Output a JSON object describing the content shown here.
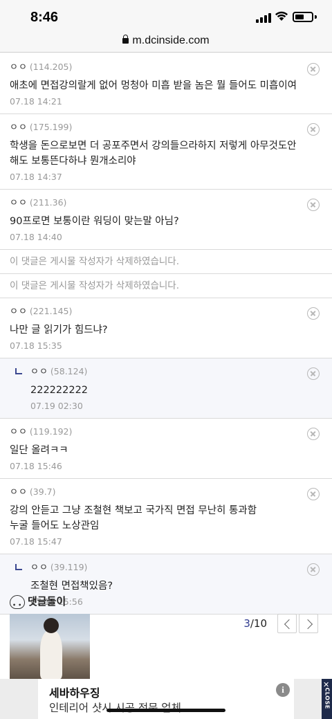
{
  "status_bar": {
    "time": "8:46"
  },
  "browser": {
    "url": "m.dcinside.com"
  },
  "comments": [
    {
      "type": "comment",
      "nick": "ㅇㅇ",
      "ip": "(114.205)",
      "text": "애초에 면접강의랄게 없어 멍청아 미흡 받을 놈은 뭘 들어도 미흡이여",
      "date": "07.18 14:21"
    },
    {
      "type": "comment",
      "nick": "ㅇㅇ",
      "ip": "(175.199)",
      "text": "학생을 돈으로보면 더 공포주면서 강의들으라하지 저렇게 아무것도안해도 보통뜬다하냐 뭔개소리야",
      "date": "07.18 14:37"
    },
    {
      "type": "comment",
      "nick": "ㅇㅇ",
      "ip": "(211.36)",
      "text": "90프로면 보통이란 워딩이 맞는말 아님?",
      "date": "07.18 14:40"
    },
    {
      "type": "deleted",
      "text": "이 댓글은 게시물 작성자가 삭제하였습니다."
    },
    {
      "type": "deleted",
      "text": "이 댓글은 게시물 작성자가 삭제하였습니다."
    },
    {
      "type": "comment",
      "nick": "ㅇㅇ",
      "ip": "(221.145)",
      "text": "나만 글 읽기가 힘드냐?",
      "date": "07.18 15:35"
    },
    {
      "type": "reply",
      "nick": "ㅇㅇ",
      "ip": "(58.124)",
      "text": "222222222",
      "date": "07.19 02:30"
    },
    {
      "type": "comment",
      "nick": "ㅇㅇ",
      "ip": "(119.192)",
      "text": "일단 올려ㅋㅋ",
      "date": "07.18 15:46"
    },
    {
      "type": "comment",
      "nick": "ㅇㅇ",
      "ip": "(39.7)",
      "text": "강의 안듣고 그냥 조철현 책보고 국가직 면접 무난히 통과함\n누굴 들어도 노상관임",
      "date": "07.18 15:47"
    },
    {
      "type": "reply",
      "nick": "ㅇㅇ",
      "ip": "(39.119)",
      "text": "조철현 면접책있음?",
      "date": "07.18 15:56"
    }
  ],
  "bot_section": {
    "title": "댓글돌이",
    "current": "3",
    "total": "/10"
  },
  "ad": {
    "title": "세바하우징",
    "subtitle": "인테리어 샷시 시공 전문 업체",
    "info": "i",
    "close_x": "✕",
    "close_label": "CLOSE"
  }
}
